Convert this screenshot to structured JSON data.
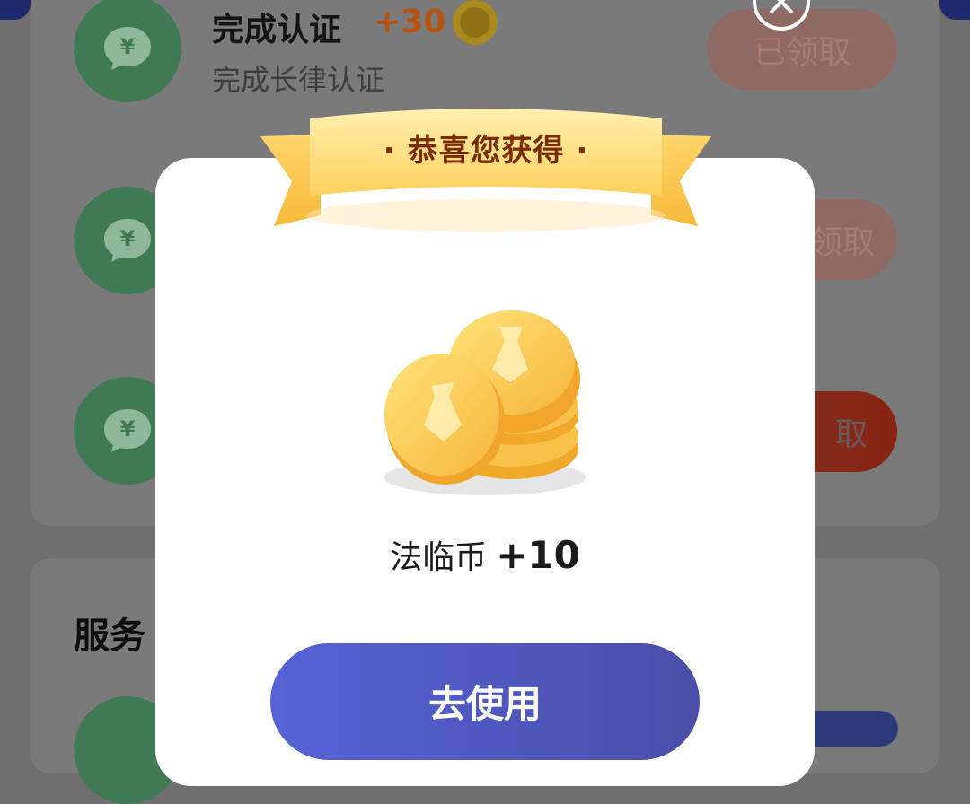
{
  "tasks": [
    {
      "title": "完成认证",
      "points": "+30",
      "description": "完成长律认证",
      "button_label": "已领取",
      "icon": "yen-chat-icon",
      "coin_icon": "coin-badge-icon"
    },
    {
      "button_label": "领取",
      "icon": "yen-chat-icon"
    },
    {
      "button_label": "取",
      "icon": "yen-chat-icon"
    }
  ],
  "services": {
    "title": "服务"
  },
  "modal": {
    "ribbon_text": "· 恭喜您获得 ·",
    "reward_name": "法临币",
    "reward_amount": "+10",
    "primary_button": "去使用",
    "close_icon": "close-icon",
    "illustration": "coin-stack-icon"
  },
  "colors": {
    "overlay": "#6f6f6f",
    "task_icon": "#3f7a55",
    "points": "#b75312",
    "ribbon_text": "#7a2c00",
    "primary_button_start": "#5663d6",
    "primary_button_end": "#4a4ea8"
  }
}
